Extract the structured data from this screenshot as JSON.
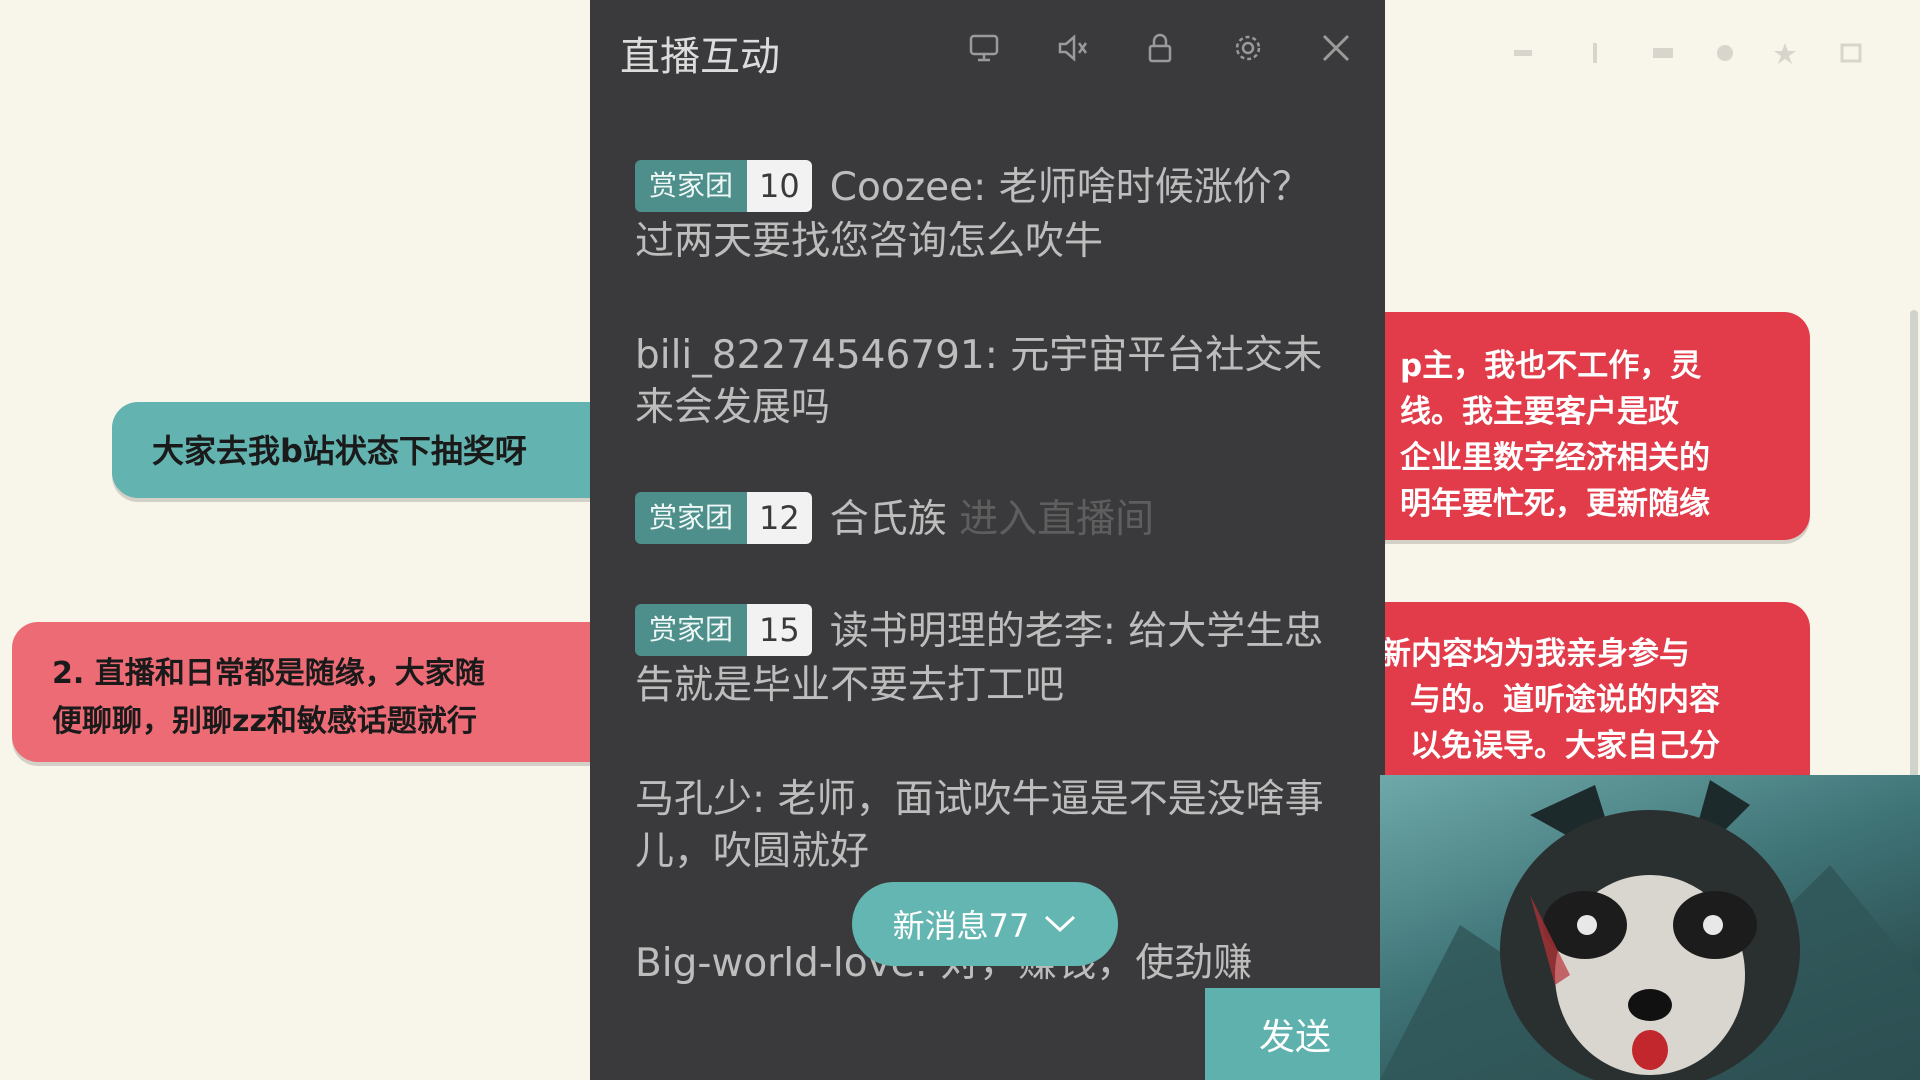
{
  "panel": {
    "title": "直播互动",
    "icons": [
      "screen-icon",
      "muted-speaker-icon",
      "lock-icon",
      "settings-gear-icon",
      "close-icon"
    ]
  },
  "messages": [
    {
      "badge": {
        "name": "赏家团",
        "level": "10"
      },
      "user": "Coozee",
      "text": "老师啥时候涨价？过两天要找您咨询怎么吹牛"
    },
    {
      "user": "bili_82274546791",
      "text": "元宇宙平台社交未来会发展吗"
    },
    {
      "badge": {
        "name": "赏家团",
        "level": "12"
      },
      "user": "合氏族",
      "text": "进入直播间"
    },
    {
      "badge": {
        "name": "赏家团",
        "level": "15"
      },
      "user": "读书明理的老李",
      "text": "给大学生忠告就是毕业不要去打工吧"
    },
    {
      "user": "马孔少",
      "text": "老师，面试吹牛逼是不是没啥事儿，吹圆就好"
    },
    {
      "user": "Big-world-love",
      "text": "对，赚钱，使劲赚"
    }
  ],
  "new_messages": {
    "label": "新消息77"
  },
  "send_button": {
    "label": "发送"
  },
  "stickers": {
    "teal_left": "大家去我b站状态下抽奖呀",
    "pink_left": [
      "2. 直播和日常都是随缘，大家随",
      "便聊聊，别聊zz和敏感话题就行"
    ],
    "red_right_top": [
      "p主，我也不工作，灵",
      "线。我主要客户是政",
      "企业里数字经济相关的",
      "明年要忙死，更新随缘"
    ],
    "red_right_bottom": [
      "新内容均为我亲身参与",
      "与的。道听途说的内容",
      "以免误导。大家自己分"
    ]
  },
  "colors": {
    "panel_bg": "#3a3a3c",
    "accent": "#63b6b2",
    "red": "#e23b4a",
    "page_bg": "#f8f5ea"
  }
}
